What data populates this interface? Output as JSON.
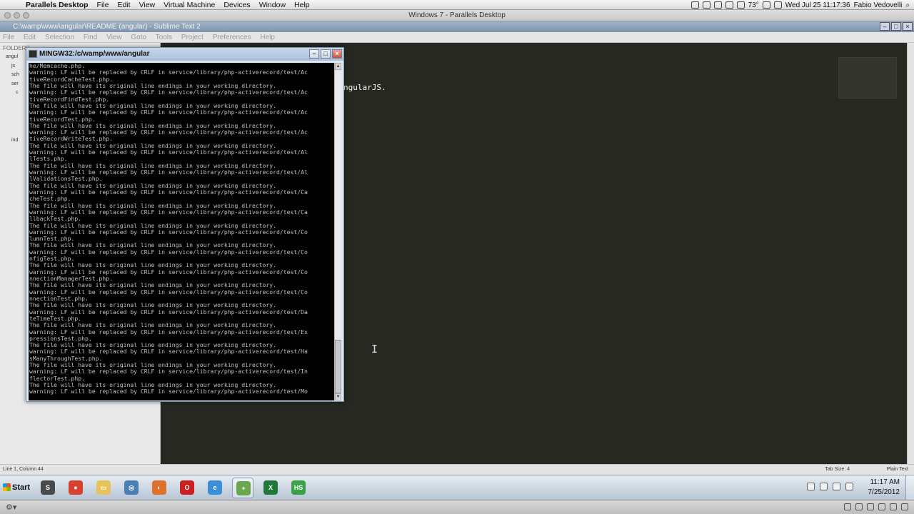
{
  "mac_menubar": {
    "app": "Parallels Desktop",
    "menus": [
      "File",
      "Edit",
      "View",
      "Virtual Machine",
      "Devices",
      "Window",
      "Help"
    ],
    "temperature": "73°",
    "datetime": "Wed Jul 25  11:17:36",
    "user": "Fabio Vedovelli"
  },
  "vm_window": {
    "title": "Windows 7 - Parallels Desktop"
  },
  "sublime": {
    "title": "C:\\wamp\\www\\angular\\README (angular) - Sublime Text 2",
    "menus": [
      "File",
      "Edit",
      "Selection",
      "Find",
      "View",
      "Goto",
      "Tools",
      "Project",
      "Preferences",
      "Help"
    ],
    "folders_header": "FOLDERS",
    "tree": [
      "angul",
      "js",
      "sch",
      "ser",
      "c",
      "ind"
    ],
    "code_visible": "ngularJS.",
    "status_left": "Line 1, Column 44",
    "tab_size": "Tab Size: 4",
    "syntax": "Plain Text"
  },
  "console": {
    "title": "MINGW32:/c/wamp/www/angular",
    "lines": [
      "he/Memcache.php.",
      "warning: LF will be replaced by CRLF in service/library/php-activerecord/test/Ac",
      "tiveRecordCacheTest.php.",
      "The file will have its original line endings in your working directory.",
      "warning: LF will be replaced by CRLF in service/library/php-activerecord/test/Ac",
      "tiveRecordFindTest.php.",
      "The file will have its original line endings in your working directory.",
      "warning: LF will be replaced by CRLF in service/library/php-activerecord/test/Ac",
      "tiveRecordTest.php.",
      "The file will have its original line endings in your working directory.",
      "warning: LF will be replaced by CRLF in service/library/php-activerecord/test/Ac",
      "tiveRecordWriteTest.php.",
      "The file will have its original line endings in your working directory.",
      "warning: LF will be replaced by CRLF in service/library/php-activerecord/test/Al",
      "lTests.php.",
      "The file will have its original line endings in your working directory.",
      "warning: LF will be replaced by CRLF in service/library/php-activerecord/test/Al",
      "lValidationsTest.php.",
      "The file will have its original line endings in your working directory.",
      "warning: LF will be replaced by CRLF in service/library/php-activerecord/test/Ca",
      "cheTest.php.",
      "The file will have its original line endings in your working directory.",
      "warning: LF will be replaced by CRLF in service/library/php-activerecord/test/Ca",
      "llbackTest.php.",
      "The file will have its original line endings in your working directory.",
      "warning: LF will be replaced by CRLF in service/library/php-activerecord/test/Co",
      "lumnTest.php.",
      "The file will have its original line endings in your working directory.",
      "warning: LF will be replaced by CRLF in service/library/php-activerecord/test/Co",
      "nfigTest.php.",
      "The file will have its original line endings in your working directory.",
      "warning: LF will be replaced by CRLF in service/library/php-activerecord/test/Co",
      "nnectionManagerTest.php.",
      "The file will have its original line endings in your working directory.",
      "warning: LF will be replaced by CRLF in service/library/php-activerecord/test/Co",
      "nnectionTest.php.",
      "The file will have its original line endings in your working directory.",
      "warning: LF will be replaced by CRLF in service/library/php-activerecord/test/Da",
      "teTimeTest.php.",
      "The file will have its original line endings in your working directory.",
      "warning: LF will be replaced by CRLF in service/library/php-activerecord/test/Ex",
      "pressionsTest.php.",
      "The file will have its original line endings in your working directory.",
      "warning: LF will be replaced by CRLF in service/library/php-activerecord/test/Ha",
      "sManyThroughTest.php.",
      "The file will have its original line endings in your working directory.",
      "warning: LF will be replaced by CRLF in service/library/php-activerecord/test/In",
      "flectorTest.php.",
      "The file will have its original line endings in your working directory.",
      "warning: LF will be replaced by CRLF in service/library/php-activerecord/test/Mo"
    ]
  },
  "taskbar": {
    "start_label": "Start",
    "apps": [
      {
        "name": "sublime-text",
        "color": "#4a4a4a",
        "glyph": "S"
      },
      {
        "name": "chrome",
        "color": "#d9412f",
        "glyph": "●"
      },
      {
        "name": "explorer",
        "color": "#e8c35a",
        "glyph": "▭"
      },
      {
        "name": "network-tool",
        "color": "#4a7fb5",
        "glyph": "◎"
      },
      {
        "name": "firefox",
        "color": "#e0712a",
        "glyph": "◐"
      },
      {
        "name": "opera",
        "color": "#cc1f1f",
        "glyph": "O"
      },
      {
        "name": "internet-explorer",
        "color": "#3a8fd8",
        "glyph": "e"
      },
      {
        "name": "git-gui",
        "color": "#6aa84f",
        "glyph": "+"
      },
      {
        "name": "excel",
        "color": "#1f7a3a",
        "glyph": "X"
      },
      {
        "name": "heidisql",
        "color": "#3aa04a",
        "glyph": "HS"
      }
    ],
    "time": "11:17 AM",
    "date": "7/25/2012"
  }
}
